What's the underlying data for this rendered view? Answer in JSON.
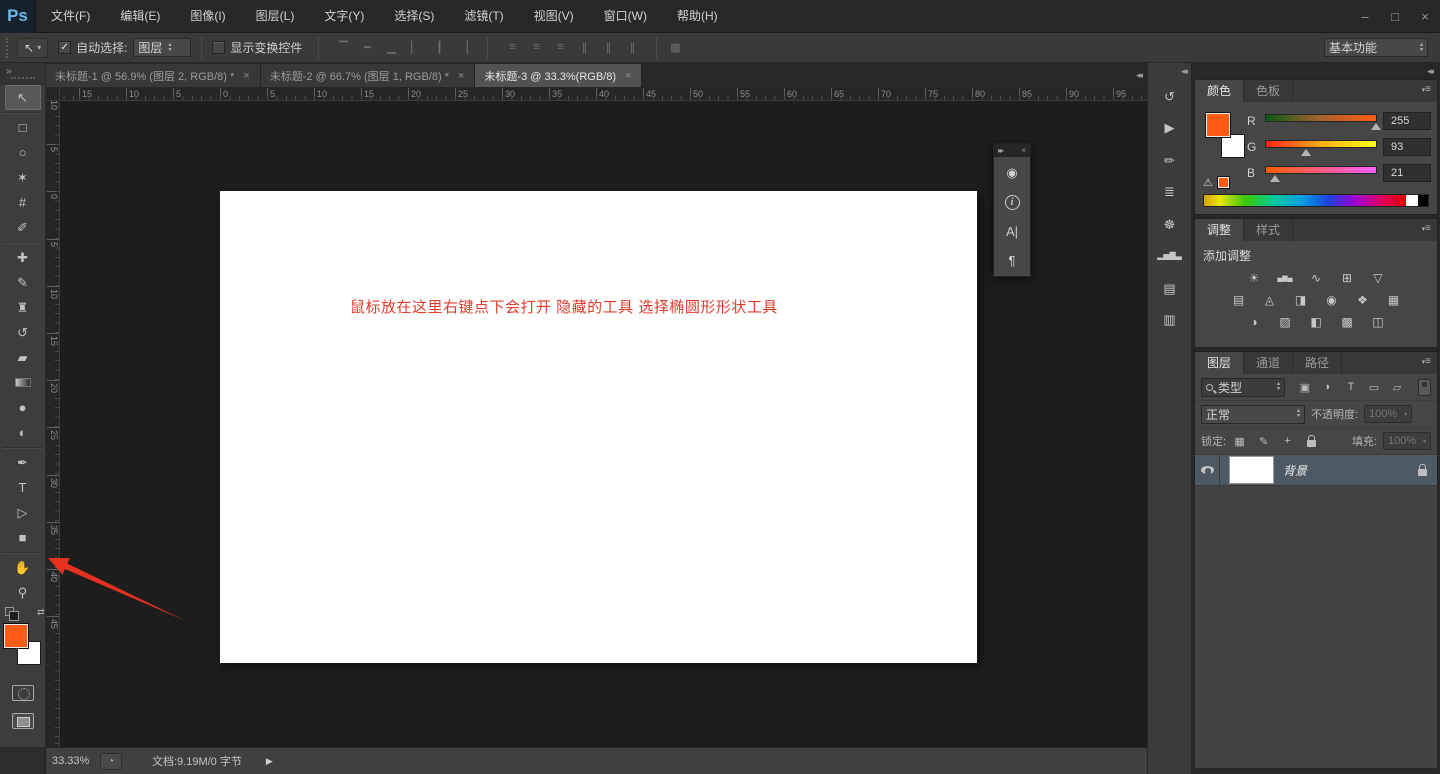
{
  "app": {
    "logo_text": "Ps",
    "workspace": "基本功能"
  },
  "window_controls": {
    "minimize": "–",
    "maximize": "□",
    "close": "×"
  },
  "ui": {
    "up": "▴",
    "down": "▾",
    "check": "✓",
    "menu": "≡",
    "menu_tri": "▾"
  },
  "menu_bar": {
    "items": [
      "文件(F)",
      "编辑(E)",
      "图像(I)",
      "图层(L)",
      "文字(Y)",
      "选择(S)",
      "滤镜(T)",
      "视图(V)",
      "窗口(W)",
      "帮助(H)"
    ]
  },
  "options_bar": {
    "tool_glyph": "↖",
    "auto_select_label": "自动选择:",
    "auto_select_value": "图层",
    "show_transform_label": "显示变换控件",
    "align_icons": [
      {
        "id": "align-top-edges-icon",
        "glyph": "▔"
      },
      {
        "id": "align-vertical-centers-icon",
        "glyph": "━"
      },
      {
        "id": "align-bottom-edges-icon",
        "glyph": "▁"
      },
      {
        "id": "align-left-edges-icon",
        "glyph": "▏"
      },
      {
        "id": "align-horizontal-centers-icon",
        "glyph": "┃"
      },
      {
        "id": "align-right-edges-icon",
        "glyph": "▕"
      }
    ],
    "distribute_icons": [
      {
        "id": "distribute-top-edges-icon",
        "glyph": "≡"
      },
      {
        "id": "distribute-vertical-centers-icon",
        "glyph": "≡"
      },
      {
        "id": "distribute-bottom-edges-icon",
        "glyph": "≡"
      },
      {
        "id": "distribute-left-edges-icon",
        "glyph": "∥"
      },
      {
        "id": "distribute-horizontal-centers-icon",
        "glyph": "∥"
      },
      {
        "id": "distribute-right-edges-icon",
        "glyph": "∥"
      }
    ],
    "auto_align_glyph": "▦"
  },
  "document_tabs": [
    {
      "label": "未标题-1 @ 56.9% (图层 2, RGB/8) *"
    },
    {
      "label": "未标题-2 @ 66.7% (图层 1, RGB/8) *"
    },
    {
      "label": "未标题-3 @ 33.3%(RGB/8)",
      "active": true
    }
  ],
  "tab_close_glyph": "×",
  "toolbar": {
    "collapse_glyph": "»",
    "tools": [
      {
        "id": "move-tool",
        "glyph": "↖",
        "selected": true
      },
      {
        "id": "rectangular-marquee-tool",
        "glyph": "□",
        "sep_before": true
      },
      {
        "id": "lasso-tool",
        "glyph": "○"
      },
      {
        "id": "quick-selection-tool",
        "glyph": "✶"
      },
      {
        "id": "crop-tool",
        "glyph": "#"
      },
      {
        "id": "eyedropper-tool",
        "glyph": "✐"
      },
      {
        "id": "spot-healing-brush-tool",
        "glyph": "✚",
        "sep_before": true
      },
      {
        "id": "brush-tool",
        "glyph": "✎"
      },
      {
        "id": "clone-stamp-tool",
        "glyph": "♜"
      },
      {
        "id": "history-brush-tool",
        "glyph": "↺"
      },
      {
        "id": "eraser-tool",
        "glyph": "▰"
      },
      {
        "id": "gradient-tool",
        "glyph": "",
        "gradient": true
      },
      {
        "id": "blur-tool",
        "glyph": "●"
      },
      {
        "id": "dodge-tool",
        "glyph": "◐"
      },
      {
        "id": "pen-tool",
        "glyph": "✒",
        "sep_before": true
      },
      {
        "id": "type-tool",
        "glyph": "T"
      },
      {
        "id": "path-selection-tool",
        "glyph": "▷"
      },
      {
        "id": "rectangle-tool",
        "glyph": "■"
      },
      {
        "id": "hand-tool",
        "glyph": "✋",
        "sep_before": true
      },
      {
        "id": "zoom-tool",
        "glyph": "⚲"
      }
    ],
    "swap_colors_glyph": "⇄"
  },
  "colors": {
    "foreground": "#FF5D15",
    "background": "#FFFFFF",
    "annotation_red": "#E23B2C"
  },
  "rulers": {
    "top_labels": [
      "15",
      "10",
      "5",
      "0",
      "5",
      "10",
      "15",
      "20",
      "25",
      "30",
      "35",
      "40",
      "45",
      "50",
      "55",
      "60",
      "65",
      "70",
      "75",
      "80",
      "85",
      "90",
      "95"
    ],
    "left_labels": [
      "10",
      "5",
      "0",
      "5",
      "10",
      "15",
      "20",
      "25",
      "30",
      "35",
      "40",
      "45"
    ]
  },
  "canvas": {
    "annotation_text": "鼠标放在这里右键点下会打开 隐藏的工具 选择椭圆形形状工具"
  },
  "floating_panel": {
    "collapse_glyph": "▸▸",
    "close_glyph": "×",
    "icons": [
      {
        "id": "dial-panel-icon",
        "glyph": "◉"
      },
      {
        "id": "info-panel-icon",
        "glyph": "i",
        "circled": true
      },
      {
        "id": "character-panel-icon",
        "glyph": "A|"
      },
      {
        "id": "paragraph-panel-icon",
        "glyph": "¶"
      }
    ]
  },
  "right_strip": {
    "collapse_glyph": "◂◂",
    "icons": [
      {
        "id": "history-panel-icon",
        "glyph": "↺",
        "grip_before": true
      },
      {
        "id": "actions-panel-icon",
        "glyph": "▶"
      },
      {
        "id": "brush-panel-icon",
        "glyph": "✏",
        "grip_before": true
      },
      {
        "id": "brush-presets-panel-icon",
        "glyph": "≣"
      },
      {
        "id": "navigator-panel-icon",
        "glyph": "☸",
        "grip_before": true
      },
      {
        "id": "histogram-panel-icon",
        "glyph": "▂▅▇▃",
        "hist": true
      },
      {
        "id": "notes-panel-icon",
        "glyph": "▤",
        "grip_before": true
      },
      {
        "id": "properties-panel-icon",
        "glyph": "▥"
      }
    ]
  },
  "color_panel": {
    "tabs": [
      {
        "label": "颜色",
        "active": true
      },
      {
        "label": "色板"
      }
    ],
    "channels": [
      {
        "label": "R",
        "value": "255",
        "cls": "slider-r"
      },
      {
        "label": "G",
        "value": "93",
        "cls": "slider-g"
      },
      {
        "label": "B",
        "value": "21",
        "cls": "slider-b"
      }
    ],
    "gamut_glyph": "⚠"
  },
  "adjustments_panel": {
    "tabs": [
      {
        "label": "调整",
        "active": true
      },
      {
        "label": "样式"
      }
    ],
    "add_label": "添加调整",
    "row1": [
      {
        "id": "brightness-contrast-icon",
        "glyph": "☀"
      },
      {
        "id": "levels-icon",
        "glyph": "▄▆▄",
        "lv": true
      },
      {
        "id": "curves-icon",
        "glyph": "∿"
      },
      {
        "id": "exposure-icon",
        "glyph": "⊞"
      },
      {
        "id": "vibrance-icon",
        "glyph": "▽"
      }
    ],
    "row2": [
      {
        "id": "hue-saturation-icon",
        "glyph": "▤"
      },
      {
        "id": "color-balance-icon",
        "glyph": "◬"
      },
      {
        "id": "black-white-icon",
        "glyph": "◨"
      },
      {
        "id": "photo-filter-icon",
        "glyph": "◉"
      },
      {
        "id": "channel-mixer-icon",
        "glyph": "❖"
      },
      {
        "id": "color-lookup-icon",
        "glyph": "▦"
      }
    ],
    "row3": [
      {
        "id": "invert-icon",
        "glyph": "◑"
      },
      {
        "id": "posterize-icon",
        "glyph": "▨"
      },
      {
        "id": "threshold-icon",
        "glyph": "◧"
      },
      {
        "id": "gradient-map-icon",
        "glyph": "▩"
      },
      {
        "id": "selective-color-icon",
        "glyph": "◫"
      }
    ]
  },
  "layers_panel": {
    "tabs": [
      {
        "label": "图层",
        "active": true
      },
      {
        "label": "通道"
      },
      {
        "label": "路径"
      }
    ],
    "filter_label": "类型",
    "filter_icons": [
      {
        "id": "filter-pixel-layers-icon",
        "glyph": "▣"
      },
      {
        "id": "filter-adjustment-layers-icon",
        "glyph": "◗"
      },
      {
        "id": "filter-type-layers-icon",
        "glyph": "T"
      },
      {
        "id": "filter-shape-layers-icon",
        "glyph": "▭"
      },
      {
        "id": "filter-smart-objects-icon",
        "glyph": "▱"
      }
    ],
    "blend_mode": "正常",
    "opacity_label": "不透明度:",
    "opacity_value": "100%",
    "lock_label": "锁定:",
    "lock_icons": [
      {
        "id": "lock-transparency-icon",
        "glyph": "▦"
      },
      {
        "id": "lock-pixels-icon",
        "glyph": "✎"
      },
      {
        "id": "lock-position-icon",
        "glyph": "+"
      },
      {
        "id": "lock-all-icon",
        "glyph": "",
        "padlock": true
      }
    ],
    "fill_label": "填充:",
    "fill_value": "100%",
    "layers": [
      {
        "name": "背景",
        "selected": true
      }
    ]
  },
  "status_bar": {
    "zoom": "33.33%",
    "icon_glyph": "◔",
    "doc_info": "文档:9.19M/0 字节",
    "menu_glyph": "▶"
  }
}
